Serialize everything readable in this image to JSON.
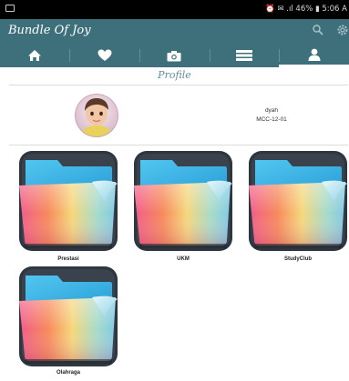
{
  "status_bar": {
    "right_text": "⏰ ✉ .ıl 46% ▮ 5:06 A"
  },
  "app_bar": {
    "title": "Bundle Of Joy",
    "actions": [
      "search-icon",
      "settings-icon"
    ]
  },
  "tabs": [
    {
      "icon": "home-icon",
      "active": false
    },
    {
      "icon": "heart-icon",
      "active": false
    },
    {
      "icon": "camera-icon",
      "active": false
    },
    {
      "icon": "list-icon",
      "active": false
    },
    {
      "icon": "user-icon",
      "active": true
    }
  ],
  "profile": {
    "heading": "Profile",
    "name": "dyah",
    "id": "MCC-12-01"
  },
  "folders": [
    {
      "label": "Prestasi"
    },
    {
      "label": "UKM"
    },
    {
      "label": "StudyClub"
    },
    {
      "label": "Olahraga"
    }
  ],
  "colors": {
    "primary": "#3e707c",
    "tab_separator": "#5e8f9a",
    "heading": "#5f8f9d"
  }
}
